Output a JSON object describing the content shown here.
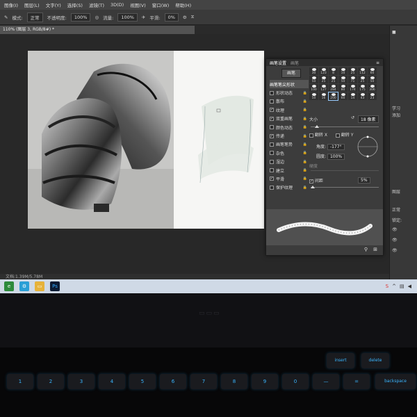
{
  "menubar": {
    "items": [
      "图像(I)",
      "图层(L)",
      "文字(Y)",
      "选择(S)",
      "滤镜(T)",
      "3D(D)",
      "视图(V)",
      "窗口(W)",
      "帮助(H)"
    ]
  },
  "options_bar": {
    "mode_label": "模式:",
    "mode_value": "正常",
    "opacity_label": "不透明度:",
    "opacity_value": "100%",
    "flow_label": "流量:",
    "flow_value": "100%",
    "smooth_label": "平滑:",
    "smooth_value": "0%"
  },
  "doc_tab": {
    "title": "110% (图层 3, RGB/8#) *"
  },
  "status_bar": {
    "text": "文档:1.39M/5.78M"
  },
  "brush_panel": {
    "tabs": [
      "画笔设置",
      "画笔"
    ],
    "presets_button": "画笔",
    "options": [
      {
        "label": "画笔笔尖形状",
        "checked": null,
        "highlight": true
      },
      {
        "label": "形状动态",
        "checked": false
      },
      {
        "label": "散布",
        "checked": false
      },
      {
        "label": "纹理",
        "checked": true
      },
      {
        "label": "双重画笔",
        "checked": true
      },
      {
        "label": "颜色动态",
        "checked": false
      },
      {
        "label": "传递",
        "checked": true
      },
      {
        "label": "画笔笔势",
        "checked": false
      },
      {
        "label": "杂色",
        "checked": false
      },
      {
        "label": "湿边",
        "checked": false
      },
      {
        "label": "建立",
        "checked": false
      },
      {
        "label": "平滑",
        "checked": true
      },
      {
        "label": "保护纹理",
        "checked": false
      }
    ],
    "tips": [
      "30",
      "123",
      "8",
      "10",
      "25",
      "112",
      "60",
      "50",
      "25",
      "25",
      "50",
      "71",
      "25",
      "50",
      "100",
      "127",
      "284",
      "80",
      "174",
      "175",
      "306",
      "50",
      "16",
      "200",
      "60",
      "14",
      "43",
      "23"
    ],
    "size_label": "大小",
    "size_value": "18 像素",
    "flip_x": "翻转 X",
    "flip_y": "翻转 Y",
    "angle_label": "角度:",
    "angle_value": "-177°",
    "roundness_label": "圆度:",
    "roundness_value": "100%",
    "hardness_label": "硬度",
    "spacing_label": "间距",
    "spacing_value": "5%"
  },
  "right_panel": {
    "learn_label": "学习",
    "add_label": "添加",
    "layers_label": "图层",
    "normal_label": "正常",
    "lock_label": "锁定:"
  },
  "taskbar": {
    "apps": [
      "edge-icon",
      "search-icon",
      "folder-icon",
      "photoshop-icon"
    ],
    "ps_label": "Ps"
  },
  "keyboard": {
    "keys": [
      "1",
      "2",
      "3",
      "4",
      "5",
      "6",
      "7",
      "8",
      "9",
      "0",
      "—",
      "="
    ],
    "backspace": "backspace",
    "insert": "insert",
    "delete": "delete"
  },
  "colors": {
    "accent": "#3ab6ff",
    "ps_blue": "#0b1b33",
    "panel": "#3c3c3c"
  }
}
